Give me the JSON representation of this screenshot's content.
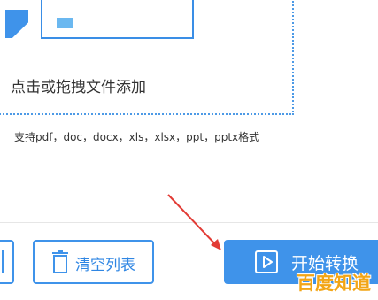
{
  "drop_zone": {
    "hint": "点击或拖拽文件添加"
  },
  "formats": {
    "text": "支持pdf，doc，docx，xls，xlsx，ppt，pptx格式"
  },
  "buttons": {
    "clear_label": "清空列表",
    "start_label": "开始转换"
  },
  "watermark": {
    "text": "百度知道"
  },
  "colors": {
    "accent": "#3f93ea",
    "arrow": "#e23b35",
    "watermark": "#f2a516"
  }
}
